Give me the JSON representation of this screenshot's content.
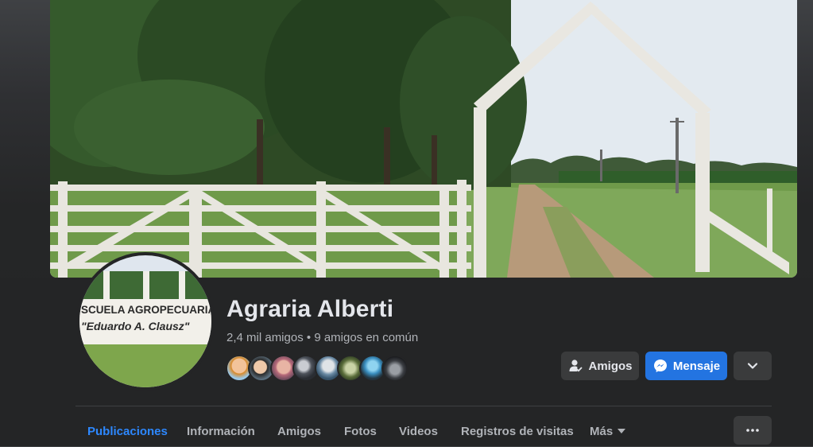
{
  "profile": {
    "name": "Agraria Alberti",
    "friends_count": "2,4 mil amigos",
    "separator": "•",
    "mutual_friends": "9 amigos en común",
    "mutual_avatars": [
      "mutual-friend-1",
      "mutual-friend-2",
      "mutual-friend-3",
      "mutual-friend-4",
      "mutual-friend-5",
      "mutual-friend-6",
      "mutual-friend-7",
      "mutual-friend-8"
    ]
  },
  "cover": {
    "scene": "farm gate with dirt road, trees and white wooden arch"
  },
  "avatar": {
    "sign_line_1": "SCUELA AGROPECUARIA N",
    "sign_line_2": "\"Eduardo A. Clausz\""
  },
  "actions": {
    "friends_label": "Amigos",
    "message_label": "Mensaje",
    "friends_icon": "person-check-icon",
    "message_icon": "messenger-icon",
    "expand_icon": "chevron-down-icon"
  },
  "tabs": [
    {
      "label": "Publicaciones",
      "active": true
    },
    {
      "label": "Información",
      "active": false
    },
    {
      "label": "Amigos",
      "active": false
    },
    {
      "label": "Fotos",
      "active": false
    },
    {
      "label": "Videos",
      "active": false
    },
    {
      "label": "Registros de visitas",
      "active": false
    },
    {
      "label": "Más",
      "active": false
    }
  ],
  "more_options_icon": "ellipsis-icon",
  "colors": {
    "background": "#242526",
    "accent": "#2d88ff",
    "button_blue": "#2374e1",
    "button_gray": "#3a3b3c",
    "text_primary": "#e4e6eb",
    "text_secondary": "#b0b3b8"
  }
}
